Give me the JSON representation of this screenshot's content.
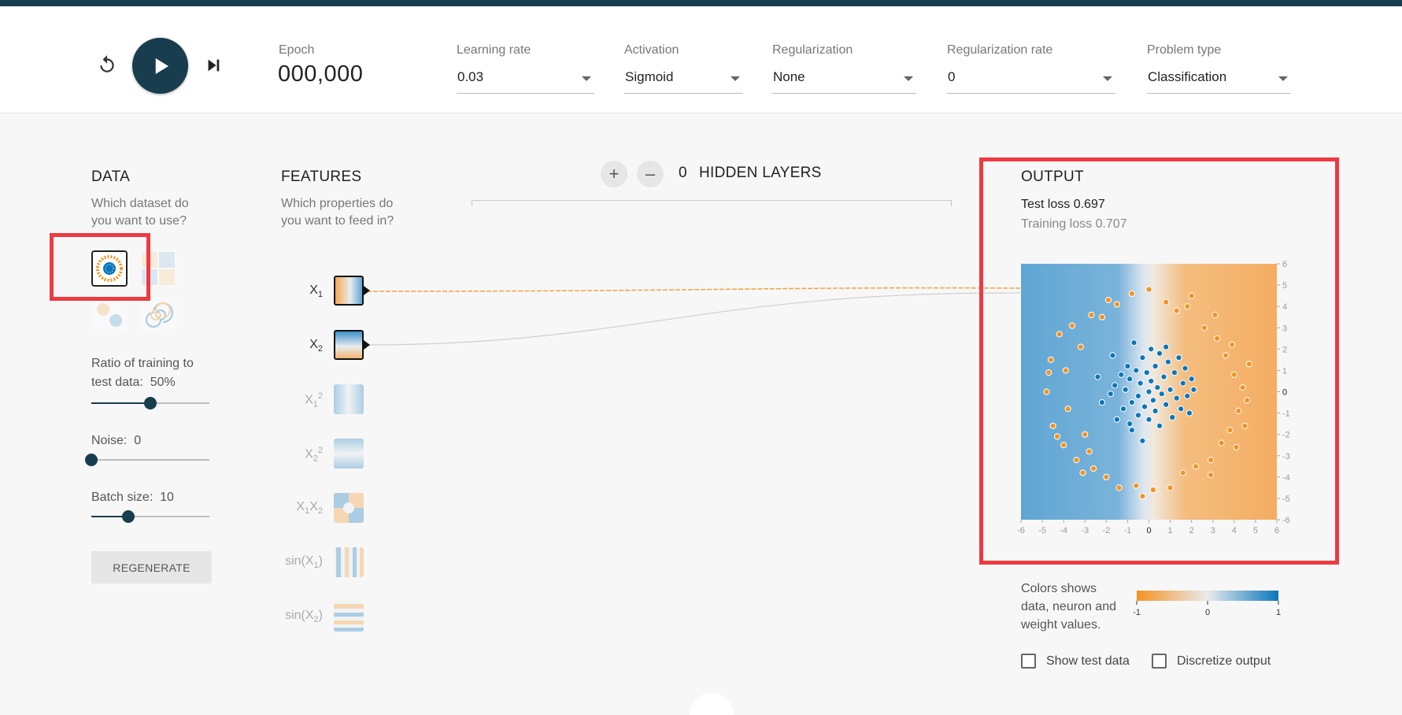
{
  "header": {
    "epoch_label": "Epoch",
    "epoch_value": "000,000",
    "selects": [
      {
        "label": "Learning rate",
        "value": "0.03"
      },
      {
        "label": "Activation",
        "value": "Sigmoid"
      },
      {
        "label": "Regularization",
        "value": "None"
      },
      {
        "label": "Regularization rate",
        "value": "0"
      },
      {
        "label": "Problem type",
        "value": "Classification"
      }
    ]
  },
  "data_panel": {
    "title": "DATA",
    "subtitle_1": "Which dataset do",
    "subtitle_2": "you want to use?",
    "ratio_label": "Ratio of training to",
    "ratio_label_2": "test data:",
    "ratio_value": "50%",
    "ratio_fraction": 0.5,
    "noise_label": "Noise:",
    "noise_value": "0",
    "noise_fraction": 0.0,
    "batch_label": "Batch size:",
    "batch_value": "10",
    "batch_fraction": 0.31,
    "regenerate_label": "REGENERATE",
    "selected_dataset": "circle"
  },
  "features_panel": {
    "title": "FEATURES",
    "subtitle_1": "Which properties do",
    "subtitle_2": "you want to feed in?",
    "features": [
      {
        "id": "x1",
        "base": "X",
        "sub": "1",
        "sup": "",
        "active": true
      },
      {
        "id": "x2",
        "base": "X",
        "sub": "2",
        "sup": "",
        "active": true
      },
      {
        "id": "x1sq",
        "base": "X",
        "sub": "1",
        "sup": "2",
        "active": false
      },
      {
        "id": "x2sq",
        "base": "X",
        "sub": "2",
        "sup": "2",
        "active": false
      },
      {
        "id": "x1x2",
        "base": "X",
        "sub": "1",
        "sup": "",
        "active": false
      },
      {
        "id": "sinx1",
        "base": "sin(X",
        "sub": "1",
        "sup": "",
        "active": false
      },
      {
        "id": "sinx2",
        "base": "sin(X",
        "sub": "2",
        "sup": "",
        "active": false
      }
    ]
  },
  "hidden_layers": {
    "plus": "+",
    "minus": "–",
    "count": "0",
    "label": "HIDDEN LAYERS"
  },
  "output": {
    "title": "OUTPUT",
    "test_loss_label": "Test loss",
    "test_loss": "0.697",
    "training_loss_label": "Training loss",
    "training_loss": "0.707",
    "axis_ticks_x": [
      "-6",
      "-5",
      "-4",
      "-3",
      "-2",
      "-1",
      "0",
      "1",
      "2",
      "3",
      "4",
      "5",
      "6"
    ],
    "axis_ticks_y": [
      "6",
      "5",
      "4",
      "3",
      "2",
      "1",
      "0",
      "-1",
      "-2",
      "-3",
      "-4",
      "-5",
      "-6"
    ],
    "legend_text": "Colors shows data, neuron and weight values.",
    "legend_ticks": [
      "-1",
      "0",
      "1"
    ],
    "show_test_data": "Show test data",
    "discretize_output": "Discretize output"
  },
  "colors": {
    "orange": "#f59322",
    "blue": "#0877bd",
    "dark": "#183d4e",
    "highlight": "#ee3a41"
  },
  "chart_data": {
    "type": "scatter",
    "xlim": [
      -6,
      6
    ],
    "ylim": [
      -6,
      6
    ],
    "series": [
      {
        "name": "",
        "color": "#0877bd",
        "points": [
          [
            -1.8,
            -0.1
          ],
          [
            -1.7,
            1.7
          ],
          [
            -1.6,
            0.3
          ],
          [
            -1.5,
            -1.3
          ],
          [
            -1.3,
            0.8
          ],
          [
            -1.2,
            -0.8
          ],
          [
            -1.1,
            0.1
          ],
          [
            -1.0,
            1.2
          ],
          [
            -0.9,
            -1.5
          ],
          [
            -0.9,
            0.6
          ],
          [
            -0.8,
            -0.5
          ],
          [
            -0.7,
            2.3
          ],
          [
            -0.6,
            1.0
          ],
          [
            -0.5,
            -0.2
          ],
          [
            -0.5,
            -1.1
          ],
          [
            -0.4,
            0.4
          ],
          [
            -0.3,
            1.6
          ],
          [
            -0.3,
            -2.3
          ],
          [
            -0.2,
            -0.7
          ],
          [
            -0.1,
            0.9
          ],
          [
            0.0,
            0.0
          ],
          [
            0.0,
            -1.3
          ],
          [
            0.1,
            2.0
          ],
          [
            0.1,
            0.5
          ],
          [
            0.2,
            -0.4
          ],
          [
            0.3,
            1.2
          ],
          [
            0.3,
            -0.9
          ],
          [
            0.4,
            0.2
          ],
          [
            0.5,
            -1.6
          ],
          [
            0.5,
            1.8
          ],
          [
            0.6,
            -0.1
          ],
          [
            0.7,
            0.7
          ],
          [
            0.8,
            -0.6
          ],
          [
            0.9,
            1.4
          ],
          [
            1.0,
            0.1
          ],
          [
            1.1,
            -1.2
          ],
          [
            1.2,
            0.9
          ],
          [
            1.3,
            -0.3
          ],
          [
            1.4,
            1.6
          ],
          [
            1.5,
            -0.8
          ],
          [
            1.6,
            0.4
          ],
          [
            1.8,
            -0.2
          ],
          [
            1.9,
            -1.0
          ],
          [
            2.0,
            0.6
          ],
          [
            2.1,
            0.1
          ],
          [
            -2.4,
            0.7
          ],
          [
            -2.2,
            -0.5
          ],
          [
            -0.8,
            -1.8
          ],
          [
            0.8,
            2.1
          ],
          [
            1.7,
            1.1
          ]
        ]
      },
      {
        "name": "",
        "color": "#f59322",
        "points": [
          [
            -4.8,
            0.0
          ],
          [
            -4.6,
            1.5
          ],
          [
            -4.5,
            -1.6
          ],
          [
            -4.2,
            2.7
          ],
          [
            -4.0,
            -2.5
          ],
          [
            -3.9,
            1.0
          ],
          [
            -3.8,
            -0.8
          ],
          [
            -3.6,
            3.1
          ],
          [
            -3.4,
            -3.2
          ],
          [
            -3.2,
            2.1
          ],
          [
            -3.0,
            -2.0
          ],
          [
            -2.7,
            3.6
          ],
          [
            -2.6,
            -3.6
          ],
          [
            -2.2,
            3.5
          ],
          [
            -2.0,
            -4.0
          ],
          [
            -1.5,
            4.1
          ],
          [
            -1.4,
            -4.5
          ],
          [
            -0.8,
            4.6
          ],
          [
            -0.6,
            -4.4
          ],
          [
            0.0,
            4.8
          ],
          [
            0.2,
            -4.6
          ],
          [
            0.8,
            4.2
          ],
          [
            1.0,
            -4.5
          ],
          [
            1.3,
            3.8
          ],
          [
            1.6,
            -3.8
          ],
          [
            2.0,
            4.5
          ],
          [
            2.2,
            -3.5
          ],
          [
            2.6,
            3.0
          ],
          [
            2.9,
            -3.2
          ],
          [
            3.2,
            2.5
          ],
          [
            3.4,
            -2.4
          ],
          [
            3.6,
            1.7
          ],
          [
            3.8,
            -1.8
          ],
          [
            4.0,
            0.8
          ],
          [
            4.2,
            -0.9
          ],
          [
            4.4,
            0.2
          ],
          [
            4.6,
            -0.4
          ],
          [
            4.7,
            1.3
          ],
          [
            4.5,
            -1.6
          ],
          [
            3.1,
            3.6
          ],
          [
            -4.3,
            -2.1
          ],
          [
            -3.1,
            -3.8
          ],
          [
            -1.9,
            4.3
          ],
          [
            -0.3,
            -4.9
          ],
          [
            1.8,
            4.0
          ],
          [
            3.9,
            2.2
          ],
          [
            4.1,
            -2.6
          ],
          [
            -4.7,
            0.9
          ],
          [
            -2.8,
            -2.8
          ],
          [
            2.9,
            -3.9
          ]
        ]
      }
    ]
  }
}
